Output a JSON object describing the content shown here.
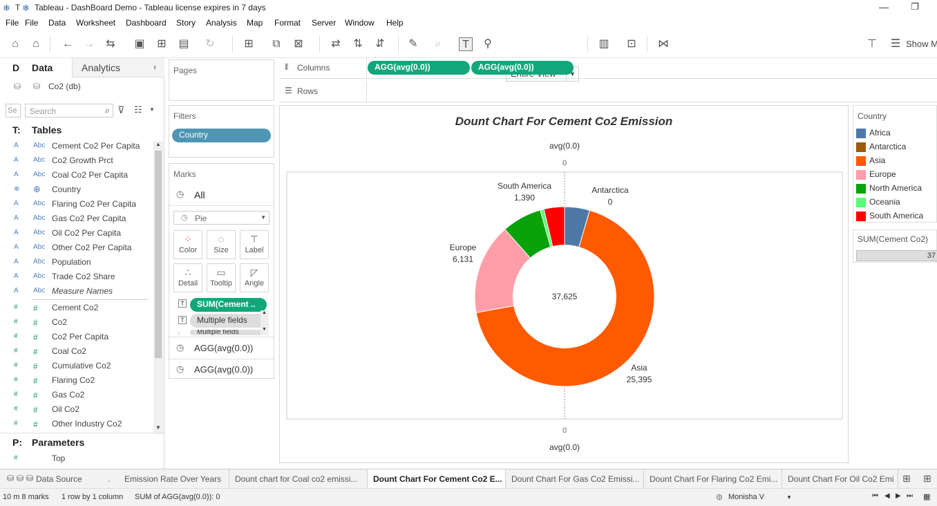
{
  "window": {
    "title": "Tableau - DashBoard Demo - Tableau license expires in 7 days",
    "title_prefix": "T"
  },
  "menu": [
    "File",
    "File",
    "Data",
    "Worksheet",
    "Dashboard",
    "Story",
    "Analysis",
    "Map",
    "Format",
    "Server",
    "Window",
    "Help"
  ],
  "toolbar": {
    "view_select": "Entire View",
    "show_me": "Show M"
  },
  "left_pane": {
    "tab_d": "D",
    "tab_data": "Data",
    "tab_analytics": "Analytics",
    "datasource": "Co2 (db)",
    "search_placeholder": "Search",
    "search_left": "Se",
    "tables_heading": "Tables",
    "tables_prefix": "T:",
    "dimensions": [
      {
        "type": "Abc",
        "name": "Cement Co2 Per Capita"
      },
      {
        "type": "Abc",
        "name": "Co2 Growth Prct"
      },
      {
        "type": "Abc",
        "name": "Coal Co2 Per Capita"
      },
      {
        "type": "geo",
        "name": "Country"
      },
      {
        "type": "Abc",
        "name": "Flaring Co2 Per Capita"
      },
      {
        "type": "Abc",
        "name": "Gas Co2 Per Capita"
      },
      {
        "type": "Abc",
        "name": "Oil Co2 Per Capita"
      },
      {
        "type": "Abc",
        "name": "Other Co2 Per Capita"
      },
      {
        "type": "Abc",
        "name": "Population"
      },
      {
        "type": "Abc",
        "name": "Trade Co2 Share"
      },
      {
        "type": "Abc",
        "name": "Measure Names"
      }
    ],
    "measures": [
      "Cement Co2",
      "Co2",
      "Co2 Per Capita",
      "Coal Co2",
      "Cumulative Co2",
      "Flaring Co2",
      "Gas Co2",
      "Oil Co2",
      "Other Industry Co2"
    ],
    "parameters_heading": "Parameters",
    "parameters_prefix": "P:",
    "parameters": [
      "Top"
    ]
  },
  "shelves": {
    "pages": "Pages",
    "filters": "Filters",
    "filter_pill": "Country",
    "marks": "Marks",
    "marks_all": "All",
    "mark_type": "Pie",
    "mark_buttons": [
      "Color",
      "Size",
      "Label",
      "Detail",
      "Tooltip",
      "Angle"
    ],
    "mark_pills": [
      "SUM(Cement ..",
      "Multiple fields",
      "Multiple fields"
    ],
    "agg_cards": [
      "AGG(avg(0.0))",
      "AGG(avg(0.0))"
    ],
    "columns_label": "Columns",
    "rows_label": "Rows",
    "columns_pills": [
      "AGG(avg(0.0))",
      "AGG(avg(0.0))"
    ]
  },
  "chart_data": {
    "type": "pie",
    "title": "Dount Chart For Cement Co2 Emission",
    "center_label": "37,625",
    "axis_top_label": "avg(0.0)",
    "axis_top_tick": "0",
    "axis_bottom_tick": "0",
    "axis_bottom_label": "avg(0.0)",
    "slices": [
      {
        "name": "Africa",
        "value": 1700,
        "color": "#4e79a7",
        "label": false
      },
      {
        "name": "Antarctica",
        "value": 0,
        "color": "#9c5a0c",
        "label": true,
        "label_value": "0"
      },
      {
        "name": "Asia",
        "value": 25395,
        "color": "#ff5a00",
        "label": true,
        "label_value": "25,395"
      },
      {
        "name": "Europe",
        "value": 6131,
        "color": "#ff9ea8",
        "label": true,
        "label_value": "6,131"
      },
      {
        "name": "North America",
        "value": 2700,
        "color": "#09a20b",
        "label": false
      },
      {
        "name": "Oceania",
        "value": 250,
        "color": "#5bff7a",
        "label": false
      },
      {
        "name": "South America",
        "value": 1390,
        "color": "#ff0000",
        "label": true,
        "label_value": "1,390"
      }
    ]
  },
  "legend": {
    "title": "Country",
    "items": [
      {
        "name": "Africa",
        "color": "#4e79a7"
      },
      {
        "name": "Antarctica",
        "color": "#9c5a0c"
      },
      {
        "name": "Asia",
        "color": "#ff5a00"
      },
      {
        "name": "Europe",
        "color": "#ff9ea8"
      },
      {
        "name": "North America",
        "color": "#09a20b"
      },
      {
        "name": "Oceania",
        "color": "#5bff7a"
      },
      {
        "name": "South America",
        "color": "#ff0000"
      }
    ],
    "size_title": "SUM(Cement Co2)",
    "size_value": "37"
  },
  "sheet_tabs": {
    "datasource": "Data Source",
    "tabs": [
      {
        "label": "Emission Rate Over Years",
        "active": false
      },
      {
        "label": "Dount chart for Coal co2 emissi...",
        "active": false
      },
      {
        "label": "Dount Chart For Cement Co2 E...",
        "active": true
      },
      {
        "label": "Dount Chart For Gas Co2 Emissi...",
        "active": false
      },
      {
        "label": "Dount Chart For Flaring Co2 Emi...",
        "active": false
      },
      {
        "label": "Dount Chart For Oil Co2 Emi",
        "active": false
      }
    ]
  },
  "status": {
    "marks": "10 m 8 marks",
    "rows": "1 row by 1 column",
    "sum": "SUM of AGG(avg(0.0)): 0",
    "user": "Monisha V"
  }
}
